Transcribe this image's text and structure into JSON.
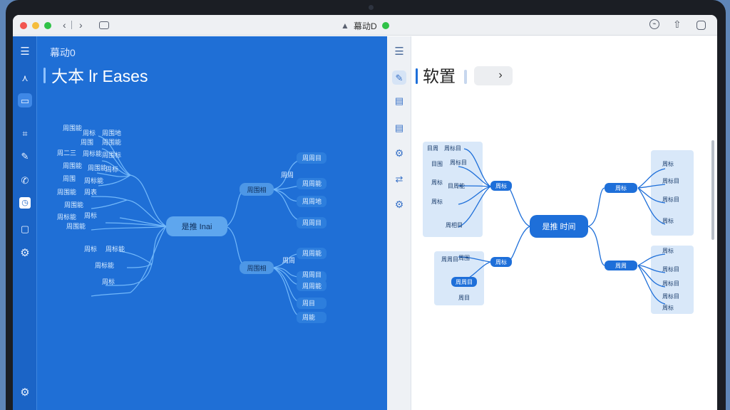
{
  "window": {
    "title": "幕动D"
  },
  "left_panel": {
    "app_name": "幕动0",
    "doc_title": "大本 lr Eases",
    "mindmap": {
      "central": "是推 Inai",
      "branches_left": [
        "周围能",
        "周标",
        "周围地",
        "周围",
        "周围能",
        "周二三",
        "周标能",
        "周围标",
        "周围能",
        "周围能",
        "周标",
        "周围",
        "周标能",
        "周围能",
        "周表",
        "周围能",
        "周标能",
        "周标",
        "周围能",
        "周标",
        "周标能",
        "周标能",
        "周标"
      ],
      "right_nodes": [
        "周围相",
        "周围相"
      ],
      "right_leaves": [
        "周周目",
        "周周",
        "周周能",
        "周周地",
        "周周目",
        "周周能",
        "周周",
        "周周目",
        "周周能",
        "周目",
        "周能"
      ]
    }
  },
  "right_panel": {
    "doc_title": "软置",
    "mindmap": {
      "central": "是推 时间",
      "groups": {
        "top_left": [
          "目周",
          "周标目",
          "目围",
          "周标目",
          "周标",
          "目周能",
          "周标",
          "周相目"
        ],
        "bottom_left": [
          "周周目",
          "周围",
          "周目"
        ],
        "top_right": [
          "周标",
          "周标目",
          "周标目",
          "周标"
        ],
        "bottom_right": [
          "周标",
          "周标目",
          "周标目",
          "周标目",
          "周标"
        ]
      },
      "nodes": [
        "周标",
        "周标",
        "周周目",
        "周标",
        "周周",
        "周周"
      ]
    }
  },
  "colors": {
    "left_bg": "#1f6fd6",
    "right_bg": "#ffffff",
    "node_blue": "#1e6fd9",
    "node_light": "#5ea6ee"
  }
}
